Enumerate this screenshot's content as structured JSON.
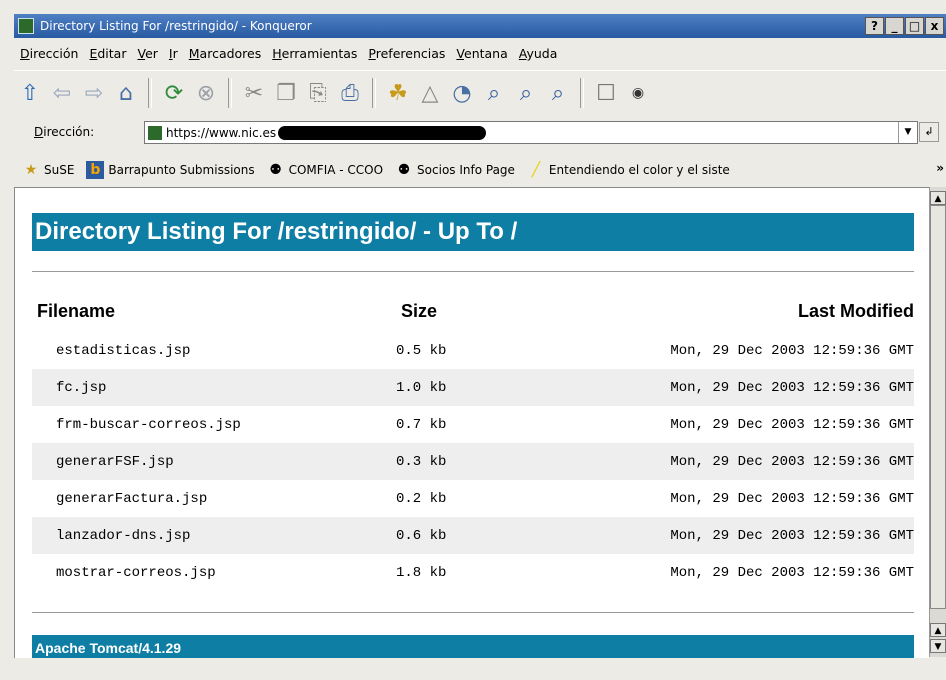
{
  "window": {
    "title": "Directory Listing For /restringido/ - Konqueror",
    "buttons": [
      "?",
      "_",
      "□",
      "x"
    ]
  },
  "menubar": {
    "items": [
      "Dirección",
      "Editar",
      "Ver",
      "Ir",
      "Marcadores",
      "Herramientas",
      "Preferencias",
      "Ventana",
      "Ayuda"
    ]
  },
  "toolbar": {
    "icons": [
      "up-arrow-icon",
      "back-arrow-icon",
      "forward-arrow-icon",
      "home-icon",
      "reload-icon",
      "stop-icon",
      "cut-icon",
      "copy-icon",
      "paste-icon",
      "print-icon",
      "security-icon",
      "text-icon",
      "find-icon",
      "zoom-icon",
      "zoom-in-icon",
      "zoom-out-icon",
      "lock-icon",
      "media-icon"
    ]
  },
  "address": {
    "label": "Dirección:",
    "url": "https://www.nic.es"
  },
  "bookmarks": [
    {
      "label": "SuSE",
      "icon": "suse-folder-icon"
    },
    {
      "label": "Barrapunto Submissions",
      "icon": "barrapunto-icon"
    },
    {
      "label": "COMFIA - CCOO",
      "icon": "penguin-icon"
    },
    {
      "label": "Socios Info Page",
      "icon": "penguin-icon"
    },
    {
      "label": "Entendiendo el color y el siste",
      "icon": "marker-icon"
    }
  ],
  "bookmarks_more": "»",
  "page": {
    "heading": "Directory Listing For /restringido/ - Up To /",
    "columns": {
      "filename": "Filename",
      "size": "Size",
      "modified": "Last Modified"
    },
    "files": [
      {
        "name": "estadisticas.jsp",
        "size": "0.5 kb",
        "modified": "Mon, 29 Dec 2003 12:59:36 GMT"
      },
      {
        "name": "fc.jsp",
        "size": "1.0 kb",
        "modified": "Mon, 29 Dec 2003 12:59:36 GMT"
      },
      {
        "name": "frm-buscar-correos.jsp",
        "size": "0.7 kb",
        "modified": "Mon, 29 Dec 2003 12:59:36 GMT"
      },
      {
        "name": "generarFSF.jsp",
        "size": "0.3 kb",
        "modified": "Mon, 29 Dec 2003 12:59:36 GMT"
      },
      {
        "name": "generarFactura.jsp",
        "size": "0.2 kb",
        "modified": "Mon, 29 Dec 2003 12:59:36 GMT"
      },
      {
        "name": "lanzador-dns.jsp",
        "size": "0.6 kb",
        "modified": "Mon, 29 Dec 2003 12:59:36 GMT"
      },
      {
        "name": "mostrar-correos.jsp",
        "size": "1.8 kb",
        "modified": "Mon, 29 Dec 2003 12:59:36 GMT"
      }
    ],
    "footer": "Apache Tomcat/4.1.29"
  },
  "colors": {
    "header_bar": "#0f7ea4",
    "titlebar": "#285aa2"
  }
}
